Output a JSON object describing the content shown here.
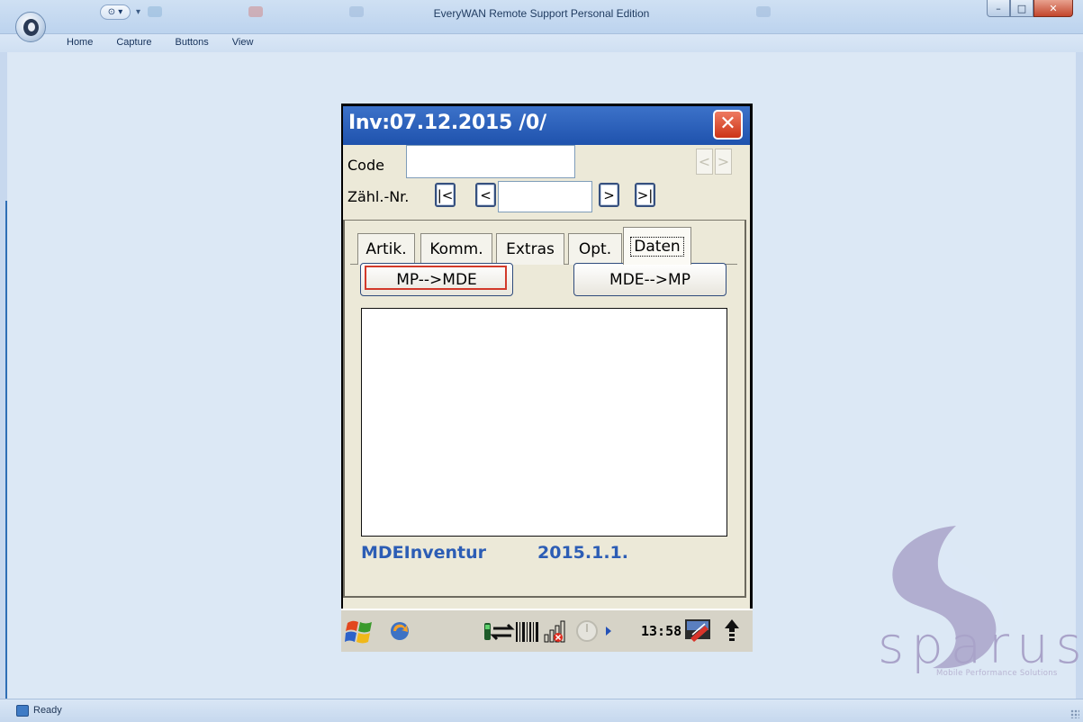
{
  "window": {
    "title": "EveryWAN Remote Support Personal Edition",
    "qat_glyph": "⊙ ▾",
    "qat_dropdown": "▾",
    "controls": {
      "minimize": "–",
      "maximize": "□",
      "close": "✕"
    }
  },
  "menu": [
    "Home",
    "Capture",
    "Buttons",
    "View"
  ],
  "status": {
    "text": "Ready"
  },
  "device": {
    "title": "Inv:07.12.2015 /0/",
    "close": "✕",
    "code_label": "Code",
    "code_value": "",
    "nav_prev": "<",
    "nav_next": ">",
    "count_label": "Zähl.-Nr.",
    "count_value": "",
    "btn_first": "|<",
    "btn_prev": "<",
    "btn_next": ">",
    "btn_last": ">|",
    "tabs": [
      "Artik.",
      "Komm.",
      "Extras",
      "Opt.",
      "Daten"
    ],
    "active_tab": "Daten",
    "btn_mp_to_mde": "MP-->MDE",
    "btn_mde_to_mp": "MDE-->MP",
    "app_name": "MDEInventur",
    "version": "2015.1.1.",
    "clock": "13:58"
  },
  "brand": {
    "name": "sparus",
    "tagline": "Mobile Performance Solutions"
  },
  "colors": {
    "device_title_bar": "#2a5fbc",
    "footer_text": "#2c5db5",
    "focus_outline": "#d23a2b",
    "brand": "#a9a3c9"
  }
}
